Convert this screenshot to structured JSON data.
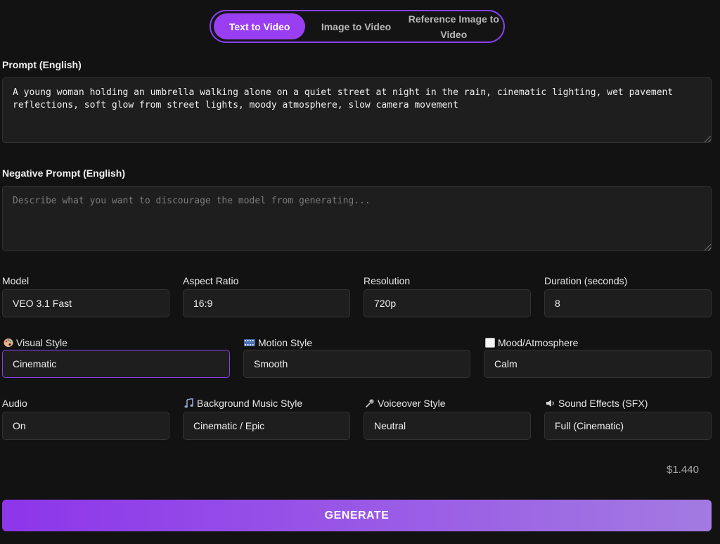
{
  "tabs": [
    {
      "label": "Text to Video",
      "active": true
    },
    {
      "label": "Image to Video",
      "active": false
    },
    {
      "label": "Reference Image to Video",
      "active": false
    }
  ],
  "prompt": {
    "label": "Prompt (English)",
    "value": "A young woman holding an umbrella walking alone on a quiet street at night in the rain, cinematic lighting, wet pavement reflections, soft glow from street lights, moody atmosphere, slow camera movement"
  },
  "negative_prompt": {
    "label": "Negative Prompt (English)",
    "value": "",
    "placeholder": "Describe what you want to discourage the model from generating..."
  },
  "row1": {
    "model": {
      "label": "Model",
      "value": "VEO 3.1 Fast"
    },
    "aspect_ratio": {
      "label": "Aspect Ratio",
      "value": "16:9"
    },
    "resolution": {
      "label": "Resolution",
      "value": "720p"
    },
    "duration": {
      "label": "Duration (seconds)",
      "value": "8"
    }
  },
  "row2": {
    "visual_style": {
      "label": "Visual Style",
      "icon": "palette-icon",
      "value": "Cinematic"
    },
    "motion_style": {
      "label": "Motion Style",
      "icon": "film-frames-icon",
      "value": "Smooth"
    },
    "mood": {
      "label": "Mood/Atmosphere",
      "icon": "blank-square-icon",
      "value": "Calm"
    }
  },
  "row3": {
    "audio": {
      "label": "Audio",
      "value": "On"
    },
    "music": {
      "label": "Background Music Style",
      "icon": "music-notes-icon",
      "value": "Cinematic / Epic"
    },
    "voiceover": {
      "label": "Voiceover Style",
      "icon": "microphone-icon",
      "value": "Neutral"
    },
    "sfx": {
      "label": "Sound Effects (SFX)",
      "icon": "speaker-icon",
      "value": "Full (Cinematic)"
    }
  },
  "price": "$1.440",
  "generate_label": "GENERATE",
  "colors": {
    "accent": "#9a3ef2",
    "background": "#121212",
    "field": "#1e1e1e"
  }
}
